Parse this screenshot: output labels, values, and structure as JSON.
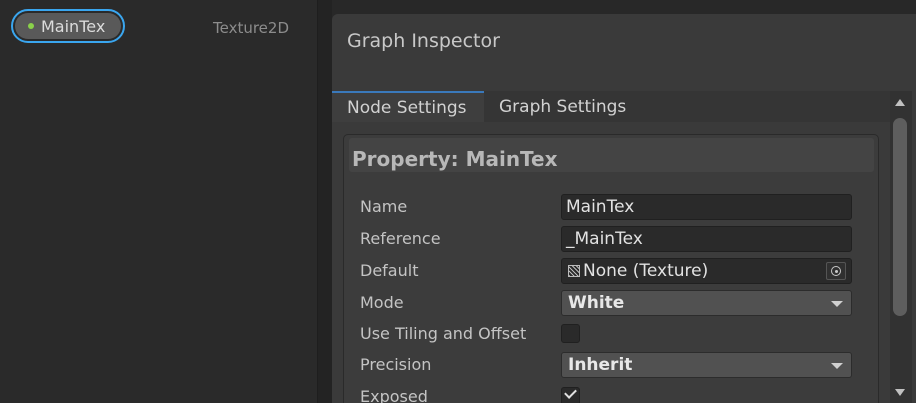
{
  "blackboard": {
    "property": {
      "name": "MainTex",
      "type": "Texture2D"
    }
  },
  "inspector": {
    "title": "Graph Inspector",
    "tabs": [
      "Node Settings",
      "Graph Settings"
    ],
    "active_tab": "Node Settings",
    "section_title": "Property: MainTex",
    "fields": {
      "name": {
        "label": "Name",
        "value": "MainTex"
      },
      "reference": {
        "label": "Reference",
        "value": "_MainTex"
      },
      "default": {
        "label": "Default",
        "value": "None (Texture)",
        "icon": "texture-icon"
      },
      "mode": {
        "label": "Mode",
        "value": "White"
      },
      "use_tiling": {
        "label": "Use Tiling and Offset",
        "checked": false
      },
      "precision": {
        "label": "Precision",
        "value": "Inherit"
      },
      "exposed": {
        "label": "Exposed",
        "checked": true
      }
    }
  },
  "colors": {
    "accent": "#3aa6ef",
    "property_dot": "#8ad14a",
    "tab_underline": "#3a79bb"
  }
}
